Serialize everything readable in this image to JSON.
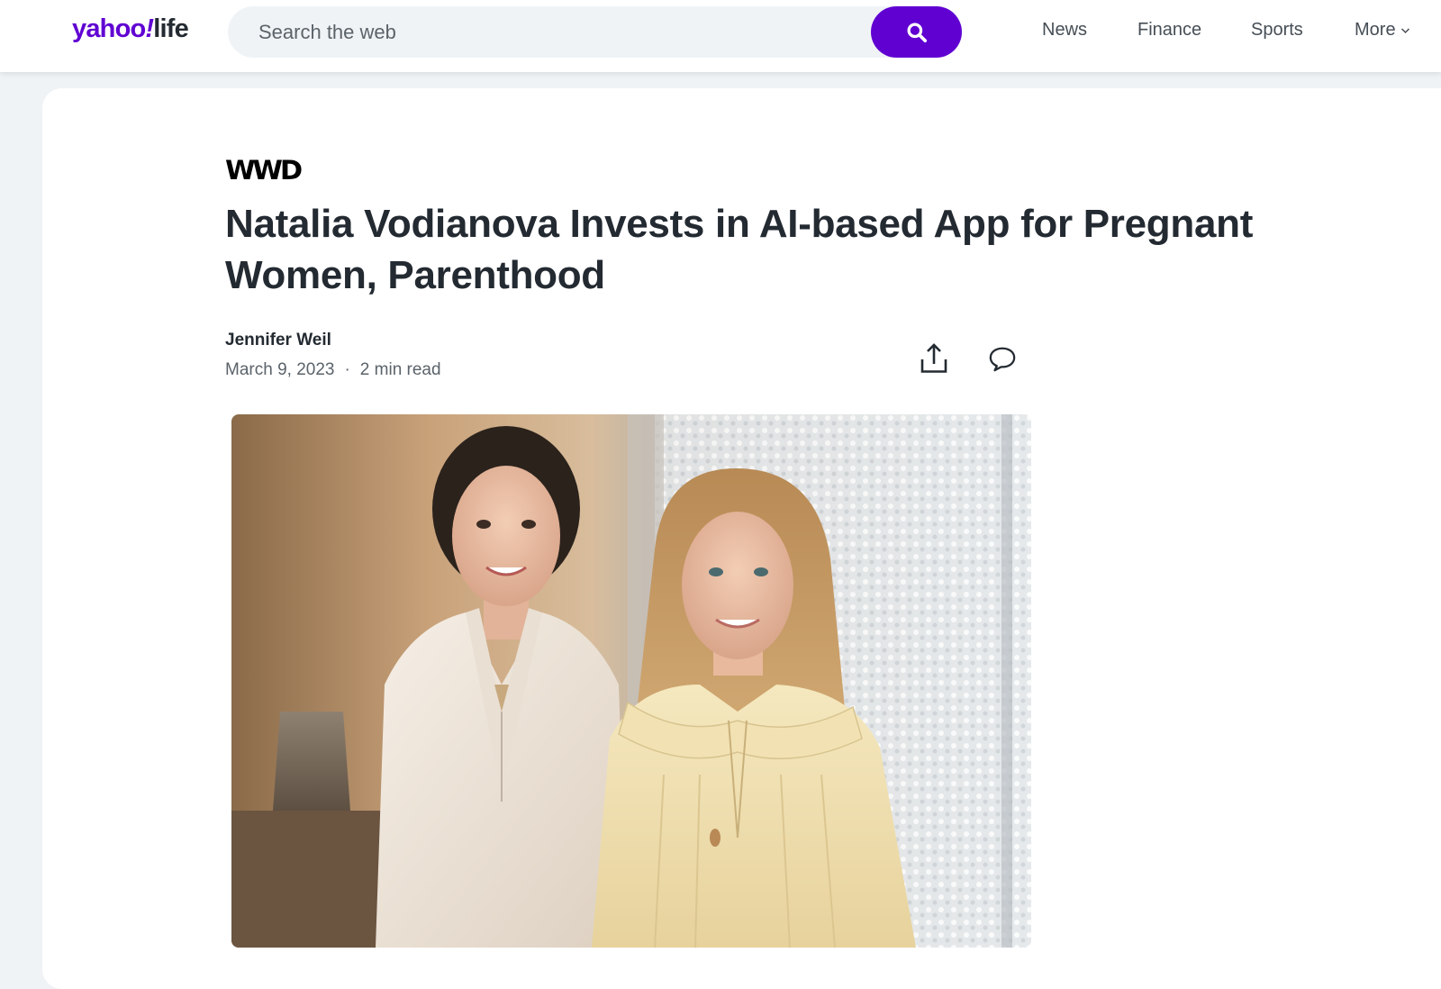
{
  "header": {
    "logo_brand": "yahoo",
    "logo_bang": "!",
    "logo_section": "life",
    "search_placeholder": "Search the web",
    "nav": [
      {
        "label": "News"
      },
      {
        "label": "Finance"
      },
      {
        "label": "Sports"
      },
      {
        "label": "More"
      }
    ]
  },
  "article": {
    "source": "WWD",
    "headline": "Natalia Vodianova Invests in AI-based App for Pregnant Women, Parenthood",
    "author": "Jennifer Weil",
    "date": "March 9, 2023",
    "separator": "·",
    "read_time": "2 min read",
    "actions": [
      {
        "icon": "share-icon"
      },
      {
        "icon": "comment-icon"
      }
    ]
  },
  "colors": {
    "brand_purple": "#6001d2",
    "headline": "#232a31",
    "meta_gray": "#5b636a",
    "page_bg": "#f0f3f5"
  }
}
